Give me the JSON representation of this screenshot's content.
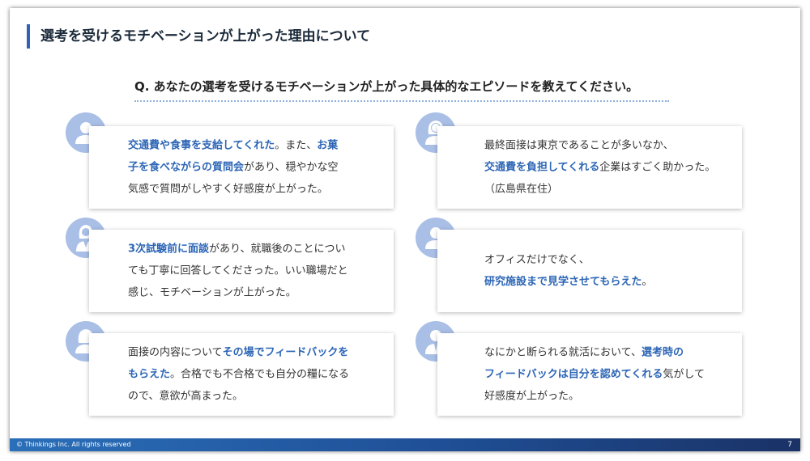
{
  "slide": {
    "title": "選考を受けるモチベーションが上がった理由について",
    "question": "Q. あなたの選考を受けるモチベーションが上がった具体的なエピソードを教えてください。"
  },
  "icons": {
    "male_user": "male-user-icon",
    "female_user": "female-user-icon",
    "businesswoman": "businesswoman-icon",
    "businessman": "businessman-icon"
  },
  "colors": {
    "accent": "#2f63b5",
    "highlight_text": "#2d66b6",
    "avatar_blue": "#a9bfe6",
    "footer_start": "#2a6fb9",
    "footer_end": "#1a3266"
  },
  "cards": [
    {
      "icon": "male-user-icon",
      "lines": [
        [
          {
            "t": "交通費や食事を支給してくれた",
            "h": true
          },
          {
            "t": "。また、",
            "h": false
          },
          {
            "t": "お菓",
            "h": true
          }
        ],
        [
          {
            "t": "子を食べながらの質問会",
            "h": true
          },
          {
            "t": "があり、穏やかな空",
            "h": false
          }
        ],
        [
          {
            "t": "気感で質問がしやすく好感度が上がった。",
            "h": false
          }
        ]
      ]
    },
    {
      "icon": "female-user-icon",
      "lines": [
        [
          {
            "t": "最終面接は東京であることが多いなか、",
            "h": false
          }
        ],
        [
          {
            "t": "交通費を負担してくれる",
            "h": true
          },
          {
            "t": "企業はすごく助かった。",
            "h": false
          }
        ],
        [
          {
            "t": "（広島県在住）",
            "h": false
          }
        ]
      ]
    },
    {
      "icon": "businesswoman-icon",
      "lines": [
        [
          {
            "t": "3次試験前に面談",
            "h": true
          },
          {
            "t": "があり、就職後のことについ",
            "h": false
          }
        ],
        [
          {
            "t": "ても丁寧に回答してくださった。いい職場だと",
            "h": false
          }
        ],
        [
          {
            "t": "感じ、モチベーションが上がった。",
            "h": false
          }
        ]
      ]
    },
    {
      "icon": "male-user-icon",
      "lines": [
        [
          {
            "t": "オフィスだけでなく、",
            "h": false
          }
        ],
        [
          {
            "t": "研究施設まで見学させてもらえた",
            "h": true
          },
          {
            "t": "。",
            "h": false
          }
        ]
      ]
    },
    {
      "icon": "female-user-icon",
      "lines": [
        [
          {
            "t": "面接の内容について",
            "h": false
          },
          {
            "t": "その場でフィードバックを",
            "h": true
          }
        ],
        [
          {
            "t": "もらえた",
            "h": true
          },
          {
            "t": "。合格でも不合格でも自分の糧になる",
            "h": false
          }
        ],
        [
          {
            "t": "ので、意欲が高まった。",
            "h": false
          }
        ]
      ]
    },
    {
      "icon": "businessman-icon",
      "lines": [
        [
          {
            "t": "なにかと断られる就活において、",
            "h": false
          },
          {
            "t": "選考時の",
            "h": true
          }
        ],
        [
          {
            "t": "フィードバックは自分を認めてくれる",
            "h": true
          },
          {
            "t": "気がして",
            "h": false
          }
        ],
        [
          {
            "t": "好感度が上がった。",
            "h": false
          }
        ]
      ]
    }
  ],
  "footer": {
    "copyright": "© Thinkings Inc. All rights reserved",
    "page_number": "7"
  }
}
